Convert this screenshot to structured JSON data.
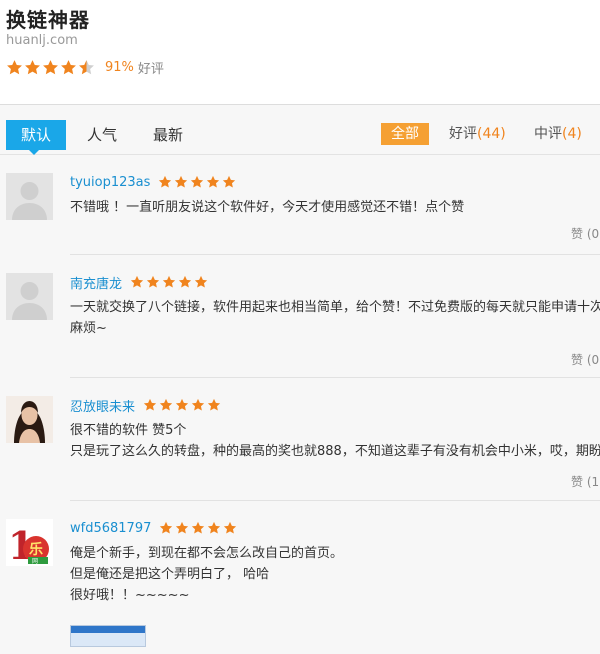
{
  "app": {
    "title": "换链神器",
    "domain": "huanlj.com",
    "rating_percent": "91%",
    "rating_word": "好评",
    "stars": 4.5
  },
  "tabs": {
    "default": "默认",
    "popular": "人气",
    "latest": "最新"
  },
  "filters": {
    "all": "全部",
    "good_label": "好评",
    "good_count": "(44)",
    "mid_label": "中评",
    "mid_count": "(4)"
  },
  "colors": {
    "accent_blue": "#1aa7e8",
    "accent_orange": "#f5a033",
    "star": "#f0841e"
  },
  "reviews": [
    {
      "user": "tyuiop123as",
      "stars": 5,
      "lines": [
        "不错哦 ！一直听朋友说这个软件好，今天才使用感觉还不错！点个赞"
      ],
      "like": "赞 (0"
    },
    {
      "user": "南充唐龙",
      "stars": 5,
      "lines": [
        "一天就交换了八个链接，软件用起来也相当简单，给个赞！不过免费版的每天就只能申请十次",
        "麻烦~"
      ],
      "like": "赞 (0"
    },
    {
      "user": "忍放眼未来",
      "stars": 5,
      "lines": [
        "很不错的软件 赞5个",
        "只是玩了这么久的转盘，种的最高的奖也就888，不知道这辈子有没有机会中小米，哎，期盼"
      ],
      "like": "赞 (1"
    },
    {
      "user": "wfd5681797",
      "stars": 5,
      "lines": [
        "俺是个新手，到现在都不会怎么改自己的首页。",
        "但是俺还是把这个弄明白了， 哈哈",
        "很好哦！！~~~~~"
      ],
      "avatar_text": "1乐网"
    }
  ]
}
